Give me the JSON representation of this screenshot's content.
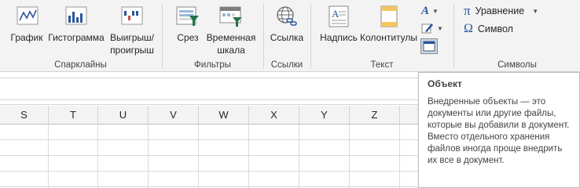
{
  "ribbon": {
    "sparklines": {
      "label": "Спарклайны",
      "buttons": [
        {
          "lines": [
            "График"
          ]
        },
        {
          "lines": [
            "Гистограмма"
          ]
        },
        {
          "lines": [
            "Выигрыш/",
            "проигрыш"
          ]
        }
      ]
    },
    "filters": {
      "label": "Фильтры",
      "buttons": [
        {
          "lines": [
            "Срез"
          ]
        },
        {
          "lines": [
            "Временная",
            "шкала"
          ]
        }
      ]
    },
    "links": {
      "label": "Ссылки",
      "buttons": [
        {
          "lines": [
            "Ссылка"
          ]
        }
      ]
    },
    "text": {
      "label": "Текст",
      "buttons": [
        {
          "lines": [
            "Надпись"
          ]
        },
        {
          "lines": [
            "Колонтитулы"
          ]
        }
      ]
    },
    "symbols": {
      "label": "Символы",
      "equation_label": "Уравнение",
      "symbol_label": "Символ"
    }
  },
  "sheet": {
    "columns": [
      "S",
      "T",
      "U",
      "V",
      "W",
      "X",
      "Y",
      "Z"
    ]
  },
  "tooltip": {
    "title": "Объект",
    "body": "Внедренные объекты — это документы или другие файлы, которые вы добавили в документ. Вместо отдельного хранения файлов иногда проще внедрить их все в документ."
  },
  "colors": {
    "accent_blue": "#2b579a",
    "icon_green": "#217346",
    "ribbon_bg": "#f3f3f3"
  }
}
